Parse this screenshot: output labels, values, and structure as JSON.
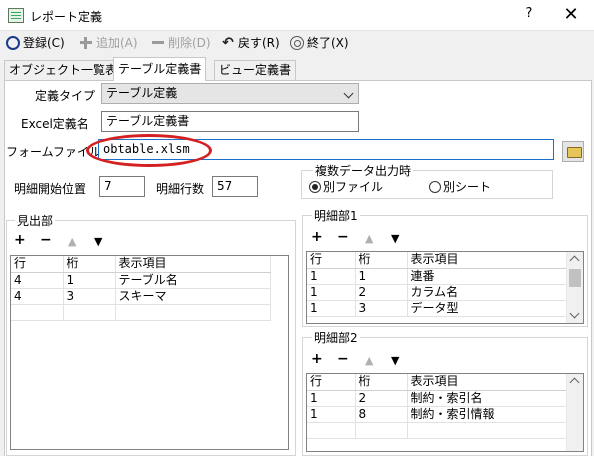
{
  "window": {
    "title": "レポート定義",
    "help": "?",
    "close": "✕"
  },
  "toolbar": {
    "register": "登録(C)",
    "add": "追加(A)",
    "delete": "削除(D)",
    "back": "戻す(R)",
    "exit": "終了(X)"
  },
  "tabs": [
    "オブジェクト一覧表",
    "テーブル定義書",
    "ビュー定義書"
  ],
  "form": {
    "type_label": "定義タイプ",
    "type_value": "テーブル定義",
    "excel_label": "Excel定義名",
    "excel_value": "テーブル定義書",
    "file_label": "フォームファイル",
    "file_value": "obtable.xlsm",
    "start_label": "明細開始位置",
    "start_value": "7",
    "rows_label": "明細行数",
    "rows_value": "57"
  },
  "multi_output": {
    "title": "複数データ出力時",
    "option_file": "別ファイル",
    "option_sheet": "別シート",
    "selected": "別ファイル"
  },
  "grid_buttons": {
    "add": "+",
    "remove": "−",
    "up": "▲",
    "down": "▼"
  },
  "headings": {
    "title": "見出部",
    "columns": [
      "行",
      "桁",
      "表示項目"
    ],
    "rows": [
      [
        "4",
        "1",
        "テーブル名"
      ],
      [
        "4",
        "3",
        "スキーマ"
      ]
    ]
  },
  "detail1": {
    "title": "明細部1",
    "columns": [
      "行",
      "桁",
      "表示項目"
    ],
    "rows": [
      [
        "1",
        "1",
        "連番"
      ],
      [
        "1",
        "2",
        "カラム名"
      ],
      [
        "1",
        "3",
        "データ型"
      ]
    ]
  },
  "detail2": {
    "title": "明細部2",
    "columns": [
      "行",
      "桁",
      "表示項目"
    ],
    "rows": [
      [
        "1",
        "2",
        "制約・索引名"
      ],
      [
        "1",
        "8",
        "制約・索引情報"
      ]
    ]
  }
}
